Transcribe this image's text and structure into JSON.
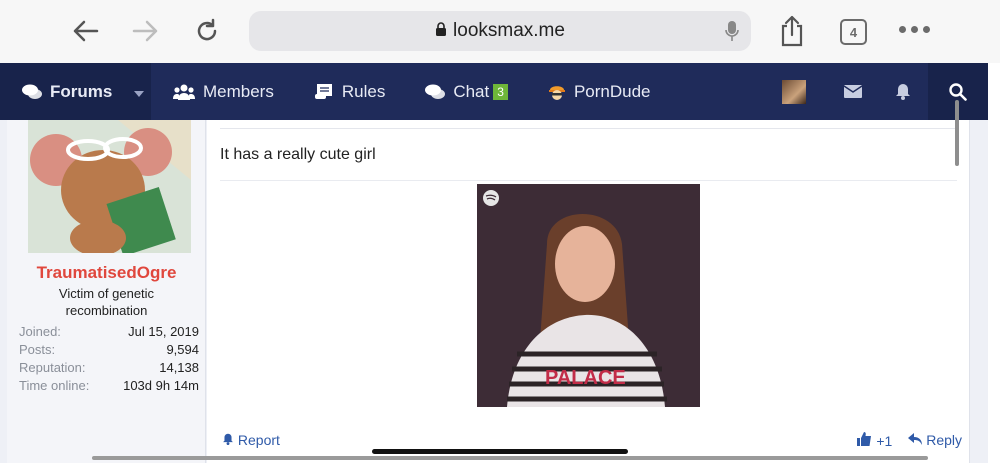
{
  "browser": {
    "url": "looksmax.me",
    "tab_count": "4"
  },
  "nav": {
    "tabs": [
      {
        "label": "Forums",
        "icon": "chat-bubbles-icon"
      },
      {
        "label": "Members",
        "icon": "users-icon"
      },
      {
        "label": "Rules",
        "icon": "scroll-icon"
      },
      {
        "label": "Chat",
        "icon": "chat-bubbles-icon",
        "badge": "3"
      },
      {
        "label": "PornDude",
        "icon": "porndude-logo-icon"
      }
    ]
  },
  "user": {
    "name": "TraumatisedOgre",
    "title": "Victim of genetic recombination",
    "stats": [
      {
        "label": "Joined:",
        "value": "Jul 15, 2019"
      },
      {
        "label": "Posts:",
        "value": "9,594"
      },
      {
        "label": "Reputation:",
        "value": "14,138"
      },
      {
        "label": "Time online:",
        "value": "103d 9h 14m"
      }
    ]
  },
  "post": {
    "text": "It has a really cute girl",
    "embed_text": "PALACE",
    "report_label": "Report",
    "like_count": "+1",
    "reply_label": "Reply"
  },
  "colors": {
    "nav_bg": "#1f2b5a",
    "username": "#e0473d",
    "link": "#2f5aa8",
    "badge": "#6eb639"
  }
}
